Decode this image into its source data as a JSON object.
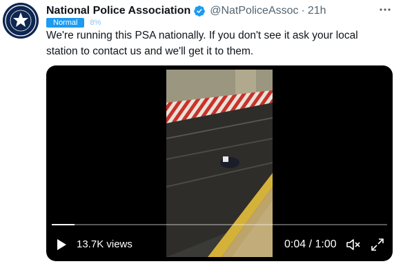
{
  "tweet": {
    "display_name": "National Police Association",
    "handle": "@NatPoliceAssoc",
    "separator": "·",
    "time": "21h",
    "more_label": "···",
    "text": "We're running this PSA nationally. If you don't see it ask your local station to contact us and we'll get it to them.",
    "verified_icon": "verified-badge-icon",
    "avatar_text": "NATIONAL POLICE ASSOCIATION"
  },
  "badge": {
    "label": "Normal",
    "percent": "8%"
  },
  "video": {
    "views": "13.7K views",
    "timecode": "0:04 / 1:00",
    "progress": 0.067,
    "play_icon": "play-icon",
    "mute_icon": "muted-speaker-icon",
    "fullscreen_icon": "fullscreen-icon"
  },
  "colors": {
    "accent": "#1d9bf0",
    "text": "#0f1419",
    "secondary": "#536471",
    "video_bg": "#000000"
  }
}
